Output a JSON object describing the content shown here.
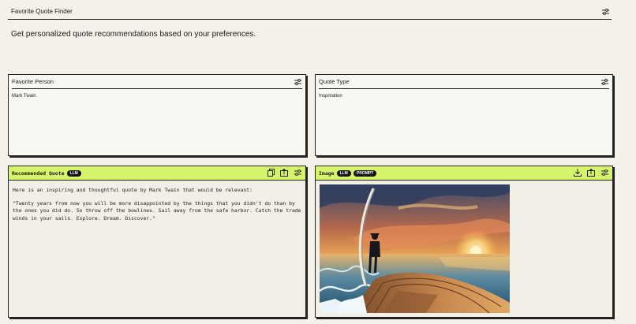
{
  "header": {
    "title": "Favorite Quote Finder",
    "settings_icon": "sliders-icon"
  },
  "subtitle": "Get personalized quote recommendations based on your preferences.",
  "inputs": [
    {
      "label": "Favorite Person",
      "value": "Mark Twain",
      "icon": "sliders-icon"
    },
    {
      "label": "Quote Type",
      "value": "Inspriration",
      "icon": "sliders-icon"
    }
  ],
  "quote_panel": {
    "label": "Recommended Quote",
    "badge": "LLM",
    "intro": "Here is an inspiring and thoughtful quote by Mark Twain that would be relevant:",
    "quote": "\"Twenty years from now you will be more disappointed by the things that you didn't do than by the ones you did do. So throw off the bowlines. Sail away from the safe harbor. Catch the trade winds in your sails. Explore. Dream. Discover.\"",
    "icons": [
      "copy-icon",
      "export-icon",
      "sliders-icon"
    ]
  },
  "image_panel": {
    "label": "Image",
    "badges": [
      "LLM",
      "PROMPT"
    ],
    "icons": [
      "download-icon",
      "export-icon",
      "sliders-icon"
    ],
    "image_alt": "Person standing on the bow of a wooden boat facing a sunset over the ocean"
  },
  "colors": {
    "accent": "#d6f46b",
    "background": "#f3f1e8",
    "border": "#222222"
  }
}
